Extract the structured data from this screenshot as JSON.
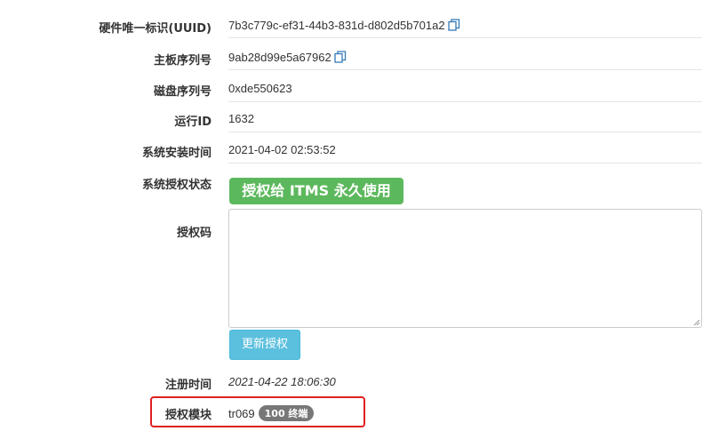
{
  "fields": {
    "uuid": {
      "label": "硬件唯一标识(UUID)",
      "value": "7b3c779c-ef31-44b3-831d-d802d5b701a2"
    },
    "board_serial": {
      "label": "主板序列号",
      "value": "9ab28d99e5a67962"
    },
    "disk_serial": {
      "label": "磁盘序列号",
      "value": "0xde550623"
    },
    "run_id": {
      "label": "运行ID",
      "value": "1632"
    },
    "install_time": {
      "label": "系统安装时间",
      "value": "2021-04-02 02:53:52"
    },
    "license_status": {
      "label": "系统授权状态",
      "badge": "授权给 ITMS 永久使用"
    },
    "license_code": {
      "label": "授权码",
      "value": ""
    },
    "update_button": "更新授权",
    "register_time": {
      "label": "注册时间",
      "value": "2021-04-22 18:06:30"
    },
    "license_module": {
      "label": "授权模块",
      "value": "tr069",
      "badge": "100 终端"
    }
  },
  "colors": {
    "success": "#5cb85c",
    "info": "#5bc0de",
    "badge_gray": "#777777",
    "highlight": "#e02020",
    "copy_icon": "#337ab7"
  },
  "icons": {
    "copy": "copy-icon"
  }
}
